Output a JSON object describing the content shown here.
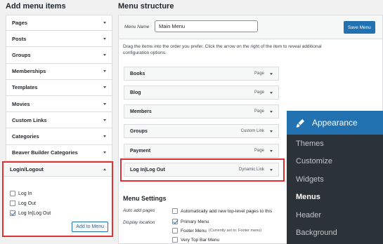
{
  "left": {
    "heading": "Add menu items",
    "sections": [
      "Pages",
      "Posts",
      "Groups",
      "Memberships",
      "Templates",
      "Movies",
      "Custom Links",
      "Categories",
      "Beaver Builder Categories"
    ],
    "login_panel": {
      "title": "Login/Logout",
      "items": [
        {
          "label": "Log In",
          "checked": false
        },
        {
          "label": "Log Out",
          "checked": false
        },
        {
          "label": "Log In|Log Out",
          "checked": true
        }
      ],
      "add_button": "Add to Menu"
    }
  },
  "right": {
    "heading": "Menu structure",
    "menu_name_label": "Menu Name",
    "menu_name_value": "Main Menu",
    "save_button": "Save Menu",
    "instructions": "Drag the items into the order you prefer. Click the arrow on the right of the item to reveal additional configuration options.",
    "items": [
      {
        "title": "Books",
        "type": "Page"
      },
      {
        "title": "Blog",
        "type": "Page"
      },
      {
        "title": "Members",
        "type": "Page"
      },
      {
        "title": "Groups",
        "type": "Custom Link"
      },
      {
        "title": "Payment",
        "type": "Page"
      },
      {
        "title": "Log In|Log Out",
        "type": "Dynamic Link"
      }
    ],
    "settings": {
      "title": "Menu Settings",
      "auto_add_label": "Auto add pages",
      "auto_add_text": "Automatically add new top-level pages to this",
      "display_label": "Display location",
      "locations": [
        {
          "label": "Primary Menu",
          "note": "",
          "checked": true
        },
        {
          "label": "Footer Menu",
          "note": "(Currently set to: Footer menu)",
          "checked": false
        },
        {
          "label": "Very Top Bar Menu",
          "note": "",
          "checked": false
        }
      ]
    }
  },
  "flyout": {
    "title": "Appearance",
    "icon": "paintbrush-icon",
    "items": [
      "Themes",
      "Customize",
      "Widgets",
      "Menus",
      "Header",
      "Background"
    ],
    "current": "Menus"
  },
  "colors": {
    "accent": "#2271b1",
    "highlight": "#e03137",
    "admin_dark": "#2c3338"
  }
}
